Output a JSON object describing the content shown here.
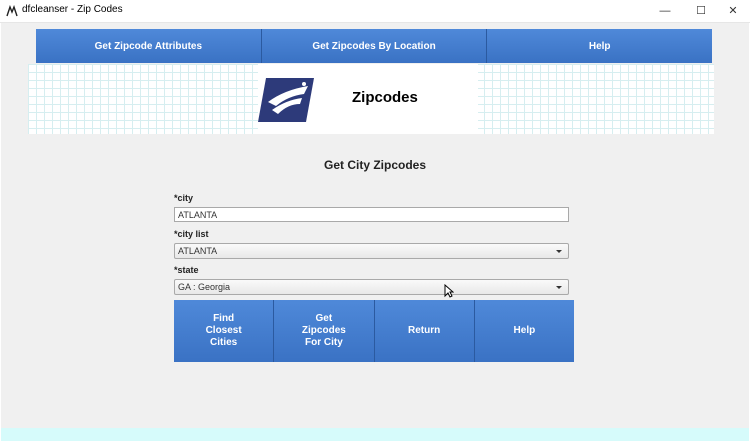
{
  "window": {
    "title": "dfcleanser - Zip Codes",
    "minimize": "—",
    "maximize": "☐",
    "close": "✕"
  },
  "nav": [
    "Get Zipcode Attributes",
    "Get Zipcodes By Location",
    "Help"
  ],
  "banner": {
    "title": "Zipcodes",
    "logo_icon": "usps-eagle-logo"
  },
  "form": {
    "title": "Get City Zipcodes",
    "city_label": "*city",
    "city_value": "ATLANTA",
    "city_list_label": "*city list",
    "city_list_value": "ATLANTA",
    "state_label": "*state",
    "state_value": "GA : Georgia"
  },
  "actions": [
    "Find\nClosest\nCities",
    "Get\nZipcodes\nFor City",
    "Return",
    "Help"
  ],
  "colors": {
    "button": "#3f7bd0",
    "footer": "#d6fbfb",
    "grid": "#d6eef0",
    "logo": "#2d3a7a"
  }
}
